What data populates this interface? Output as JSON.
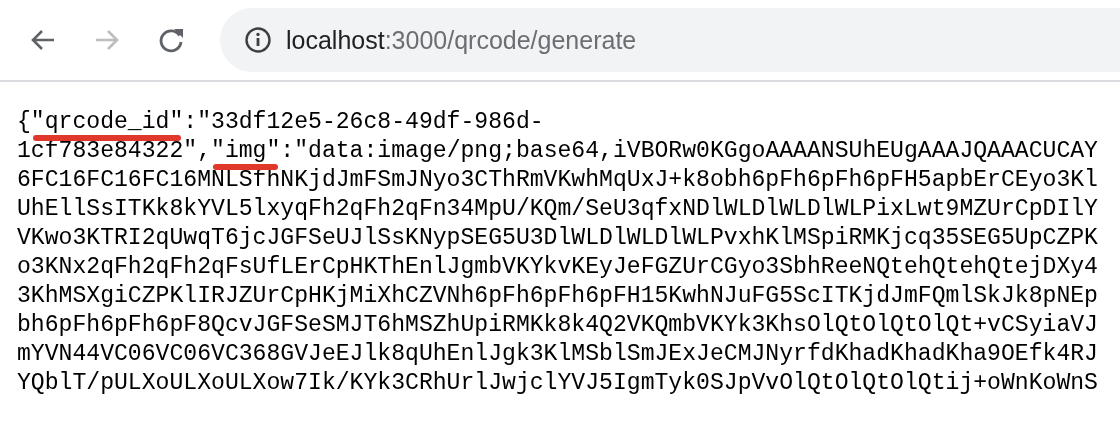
{
  "toolbar": {
    "back_disabled": false,
    "forward_disabled": true,
    "address_bar": {
      "url_host": "localhost",
      "url_path": ":3000/qrcode/generate"
    }
  },
  "body": {
    "lines": [
      {
        "segments": [
          {
            "text": "{",
            "underlined": false
          },
          {
            "text": "\"qrcode_id\"",
            "underlined": true
          },
          {
            "text": ":\"33df12e5-26c8-49df-986d-",
            "underlined": false
          }
        ]
      },
      {
        "segments": [
          {
            "text": "1cf783e84322\",",
            "underlined": false
          },
          {
            "text": "\"img\"",
            "underlined": true
          },
          {
            "text": ":\"data:image/png;base64,iVBORw0KGgoAAAANSUhEUgAAAJQAAACUCAY",
            "underlined": false
          }
        ]
      },
      {
        "segments": [
          {
            "text": "6FC16FC16FC16MNLSfhNKjdJmFSmJNyo3CThRmVKwhMqUxJ+k8obh6pFh6pFh6pFH5apbErCEyo3Kl",
            "underlined": false
          }
        ]
      },
      {
        "segments": [
          {
            "text": "UhEllSsITKk8kYVL5lxyqFh2qFh2qFn34MpU/KQm/SeU3qfxNDlWLDlWLDlWLPixLwt9MZUrCpDIlY",
            "underlined": false
          }
        ]
      },
      {
        "segments": [
          {
            "text": "VKwo3KTRI2qUwqT6jcJGFSeUJlSsKNypSEG5U3DlWLDlWLDlWLPvxhKlMSpiRMKjcq35SEG5UpCZPK",
            "underlined": false
          }
        ]
      },
      {
        "segments": [
          {
            "text": "o3KNx2qFh2qFh2qFsUfLErCpHKThEnlJgmbVKYkvKEyJeFGZUrCGyo3SbhReeNQtehQtehQtejDXy4",
            "underlined": false
          }
        ]
      },
      {
        "segments": [
          {
            "text": "3KhMSXgiCZPKlIRJZUrCpHKjMiXhCZVNh6pFh6pFh6pFH15KwhNJuFG5ScITKjdJmFQmlSkJk8pNEp",
            "underlined": false
          }
        ]
      },
      {
        "segments": [
          {
            "text": "bh6pFh6pFh6pF8QcvJGFSeSMJT6hMSZhUpiRMKk8k4Q2VKQmbVKYk3KhsOlQtOlQtOlQt+vCSyiaVJ",
            "underlined": false
          }
        ]
      },
      {
        "segments": [
          {
            "text": "mYVN44VC06VC06VC368GVJeEJlk8qUhEnlJgk3KlMSblSmJExJeCMJNyrfdKhadKhadKha9OEfk4RJ",
            "underlined": false
          }
        ]
      },
      {
        "segments": [
          {
            "text": "YQblT/pULXoULXoULXow7Ik/KYk3CRhUrlJwjclYVJ5IgmTyk0SJpVvOlQtOlQtOlQtij+oWnKoWnS",
            "underlined": false
          }
        ]
      }
    ]
  }
}
